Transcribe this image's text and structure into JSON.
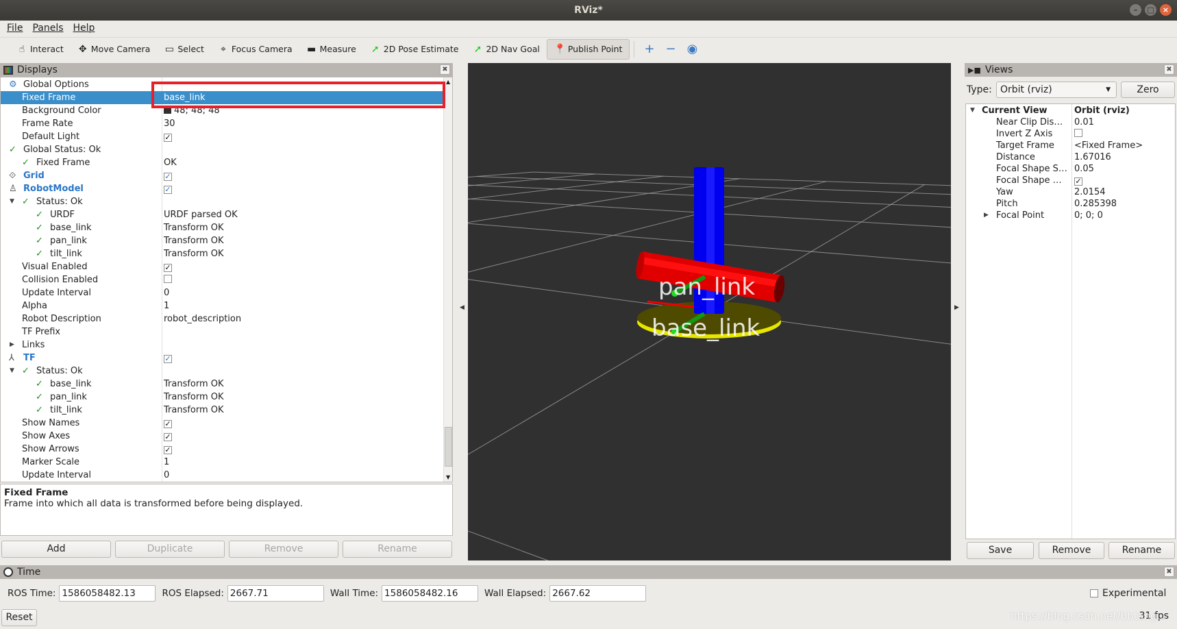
{
  "window": {
    "title": "RViz*"
  },
  "menu": [
    "File",
    "Panels",
    "Help"
  ],
  "toolbar": {
    "tools": [
      {
        "label": "Interact",
        "icon": "hand-pointer-icon",
        "glyph": "☝"
      },
      {
        "label": "Move Camera",
        "icon": "move-camera-icon",
        "glyph": "✥"
      },
      {
        "label": "Select",
        "icon": "select-box-icon",
        "glyph": "▭"
      },
      {
        "label": "Focus Camera",
        "icon": "focus-camera-icon",
        "glyph": "⌖"
      },
      {
        "label": "Measure",
        "icon": "ruler-icon",
        "glyph": "▬"
      },
      {
        "label": "2D Pose Estimate",
        "icon": "green-arrow-icon",
        "glyph": "➚"
      },
      {
        "label": "2D Nav Goal",
        "icon": "green-arrow-icon",
        "glyph": "➚"
      },
      {
        "label": "Publish Point",
        "icon": "map-pin-icon",
        "glyph": "📍",
        "active": true
      }
    ],
    "extras": [
      {
        "icon": "plus-icon",
        "glyph": "+"
      },
      {
        "icon": "minus-icon",
        "glyph": "−"
      },
      {
        "icon": "eye-icon",
        "glyph": "◉"
      }
    ]
  },
  "displays": {
    "title": "Displays",
    "rows": [
      {
        "name": "Global Options",
        "value": "",
        "depth": 0,
        "prefix": "icon",
        "icon": "gear-icon",
        "glyph": "⚙"
      },
      {
        "name": "Fixed Frame",
        "value": "base_link",
        "depth": 1,
        "selected": true
      },
      {
        "name": "Background Color",
        "value": "48; 48; 48",
        "depth": 1,
        "swatch": "#303030"
      },
      {
        "name": "Frame Rate",
        "value": "30",
        "depth": 1
      },
      {
        "name": "Default Light",
        "value": "",
        "depth": 1,
        "checkbox": true,
        "checked": true
      },
      {
        "name": "Global Status: Ok",
        "value": "",
        "depth": 0,
        "prefix": "check"
      },
      {
        "name": "Fixed Frame",
        "value": "OK",
        "depth": 1,
        "prefix": "check"
      },
      {
        "name": "Grid",
        "value": "",
        "depth": 0,
        "prefix": "icon",
        "icon": "grid-icon",
        "glyph": "⟐",
        "blue": true,
        "checkbox": true,
        "checked": true
      },
      {
        "name": "RobotModel",
        "value": "",
        "depth": 0,
        "prefix": "icon",
        "icon": "robot-icon",
        "glyph": "♙",
        "blue": true,
        "checkbox": true,
        "checked": true
      },
      {
        "name": "Status: Ok",
        "value": "",
        "depth": 1,
        "prefix": "check",
        "expander": "open"
      },
      {
        "name": "URDF",
        "value": "URDF parsed OK",
        "depth": 2,
        "prefix": "check"
      },
      {
        "name": "base_link",
        "value": "Transform OK",
        "depth": 2,
        "prefix": "check"
      },
      {
        "name": "pan_link",
        "value": "Transform OK",
        "depth": 2,
        "prefix": "check"
      },
      {
        "name": "tilt_link",
        "value": "Transform OK",
        "depth": 2,
        "prefix": "check"
      },
      {
        "name": "Visual Enabled",
        "value": "",
        "depth": 1,
        "checkbox": true,
        "checked": true
      },
      {
        "name": "Collision Enabled",
        "value": "",
        "depth": 1,
        "checkbox": true,
        "checked": false
      },
      {
        "name": "Update Interval",
        "value": "0",
        "depth": 1
      },
      {
        "name": "Alpha",
        "value": "1",
        "depth": 1
      },
      {
        "name": "Robot Description",
        "value": "robot_description",
        "depth": 1
      },
      {
        "name": "TF Prefix",
        "value": "",
        "depth": 1
      },
      {
        "name": "Links",
        "value": "",
        "depth": 1,
        "expander": "closed"
      },
      {
        "name": "TF",
        "value": "",
        "depth": 0,
        "prefix": "icon",
        "icon": "tf-axes-icon",
        "glyph": "⅄",
        "blue": true,
        "checkbox": true,
        "checked": true
      },
      {
        "name": "Status: Ok",
        "value": "",
        "depth": 1,
        "prefix": "check",
        "expander": "open"
      },
      {
        "name": "base_link",
        "value": "Transform OK",
        "depth": 2,
        "prefix": "check"
      },
      {
        "name": "pan_link",
        "value": "Transform OK",
        "depth": 2,
        "prefix": "check"
      },
      {
        "name": "tilt_link",
        "value": "Transform OK",
        "depth": 2,
        "prefix": "check"
      },
      {
        "name": "Show Names",
        "value": "",
        "depth": 1,
        "checkbox": true,
        "checked": true
      },
      {
        "name": "Show Axes",
        "value": "",
        "depth": 1,
        "checkbox": true,
        "checked": true
      },
      {
        "name": "Show Arrows",
        "value": "",
        "depth": 1,
        "checkbox": true,
        "checked": true
      },
      {
        "name": "Marker Scale",
        "value": "1",
        "depth": 1
      },
      {
        "name": "Update Interval",
        "value": "0",
        "depth": 1
      }
    ],
    "description": {
      "title": "Fixed Frame",
      "text": "Frame into which all data is transformed before being displayed."
    },
    "buttons": {
      "add": "Add",
      "duplicate": "Duplicate",
      "remove": "Remove",
      "rename": "Rename"
    },
    "highlight_color": "#e8202a"
  },
  "viewport": {
    "background": "#303030",
    "labels": [
      "pan_link",
      "base_link"
    ],
    "camera": {
      "yaw": 2.0154,
      "pitch": 0.285398,
      "distance": 1.67016
    }
  },
  "views": {
    "title": "Views",
    "type_label": "Type:",
    "type_value": "Orbit (rviz)",
    "zero": "Zero",
    "rows": [
      {
        "name": "Current View",
        "value": "Orbit (rviz)",
        "bold": true,
        "expander": "open",
        "depth": 0
      },
      {
        "name": "Near Clip Dis…",
        "value": "0.01",
        "depth": 1
      },
      {
        "name": "Invert Z Axis",
        "value": "",
        "checkbox": true,
        "checked": false,
        "depth": 1
      },
      {
        "name": "Target Frame",
        "value": "<Fixed Frame>",
        "depth": 1
      },
      {
        "name": "Distance",
        "value": "1.67016",
        "depth": 1
      },
      {
        "name": "Focal Shape S…",
        "value": "0.05",
        "depth": 1
      },
      {
        "name": "Focal Shape …",
        "value": "",
        "checkbox": true,
        "checked": true,
        "depth": 1
      },
      {
        "name": "Yaw",
        "value": "2.0154",
        "depth": 1
      },
      {
        "name": "Pitch",
        "value": "0.285398",
        "depth": 1
      },
      {
        "name": "Focal Point",
        "value": "0; 0; 0",
        "expander": "closed",
        "depth": 1
      }
    ],
    "buttons": {
      "save": "Save",
      "remove": "Remove",
      "rename": "Rename"
    }
  },
  "time": {
    "title": "Time",
    "ros_time_label": "ROS Time:",
    "ros_time": "1586058482.13",
    "ros_elapsed_label": "ROS Elapsed:",
    "ros_elapsed": "2667.71",
    "wall_time_label": "Wall Time:",
    "wall_time": "1586058482.16",
    "wall_elapsed_label": "Wall Elapsed:",
    "wall_elapsed": "2667.62",
    "experimental_label": "Experimental",
    "experimental": false,
    "reset": "Reset",
    "fps": "31 fps"
  },
  "watermark": "https://blog.csdn.net/bbtang..."
}
